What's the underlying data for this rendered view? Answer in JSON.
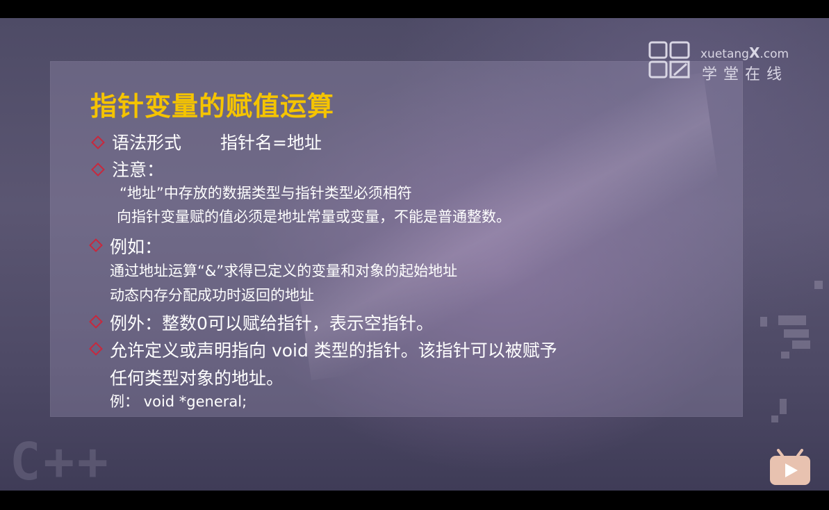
{
  "logo": {
    "name_en_prefix": "xuetang",
    "name_en_x": "X",
    "name_en_suffix": ".com",
    "name_cn": "学堂在线"
  },
  "slide": {
    "title": "指针变量的赋值运算",
    "syntax_label": "语法形式",
    "syntax_value": "指针名=地址",
    "note_label": "注意：",
    "note_lines": [
      "“地址”中存放的数据类型与指针类型必须相符",
      "向指针变量赋的值必须是地址常量或变量，不能是普通整数。"
    ],
    "example_label": "例如：",
    "example_lines": [
      "通过地址运算“&”求得已定义的变量和对象的起始地址",
      "动态内存分配成功时返回的地址"
    ],
    "exception": "例外：整数0可以赋给指针，表示空指针。",
    "void_lines": [
      "允许定义或声明指向 void 类型的指针。该指针可以被赋予",
      "任何类型对象的地址。"
    ],
    "void_example": "例： void *general;"
  },
  "watermark": "C++",
  "colors": {
    "title": "#f5c400",
    "bullet": "#c8283d",
    "text": "#ffffff"
  },
  "icons": [
    "xuetangx-logo-icon",
    "tv-player-icon"
  ]
}
